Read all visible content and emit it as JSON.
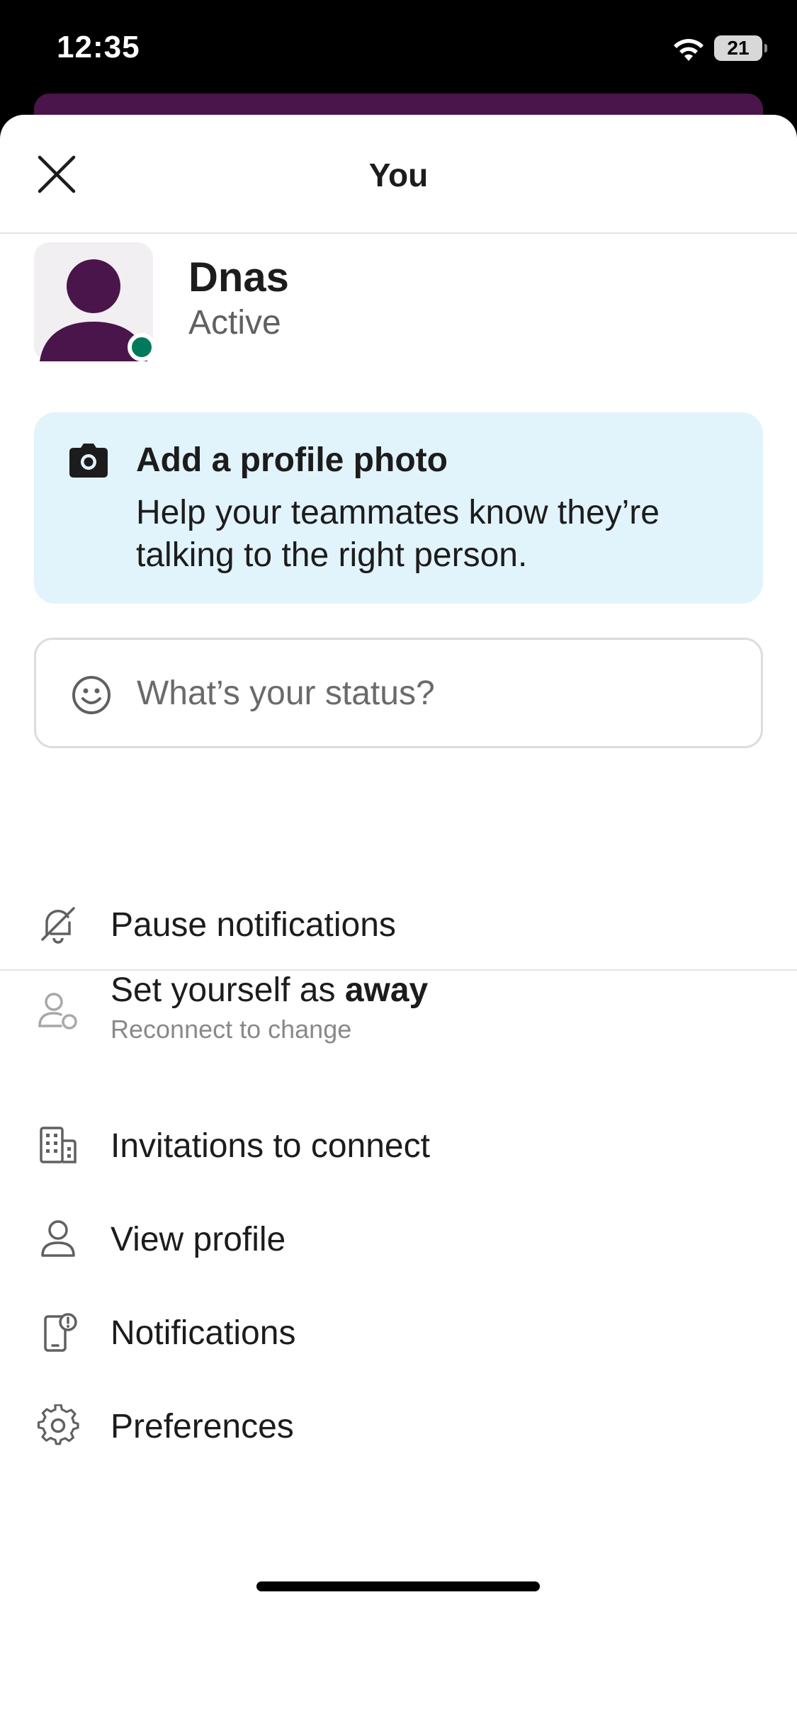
{
  "status_bar": {
    "time": "12:35",
    "battery": "21",
    "icons": [
      "wifi-icon",
      "battery-icon"
    ]
  },
  "header": {
    "title": "You",
    "close_icon": "close-icon"
  },
  "profile": {
    "name": "Dnas",
    "presence": "Active",
    "presence_color": "#007a5a",
    "avatar_color": "#4a154b"
  },
  "photo_banner": {
    "icon": "camera-icon",
    "title": "Add a profile photo",
    "description": "Help your teammates know they’re talking to the right person.",
    "background": "#e1f4fb"
  },
  "status_field": {
    "icon": "smile-icon",
    "placeholder": "What’s your status?"
  },
  "menu_top": [
    {
      "icon": "bell-off-icon",
      "label": "Pause notifications"
    },
    {
      "icon": "person-away-icon",
      "label_prefix": "Set yourself as ",
      "label_bold": "away",
      "sublabel": "Reconnect to change"
    }
  ],
  "menu_bottom": [
    {
      "icon": "building-icon",
      "label": "Invitations to connect"
    },
    {
      "icon": "person-icon",
      "label": "View profile"
    },
    {
      "icon": "phone-notification-icon",
      "label": "Notifications"
    },
    {
      "icon": "gear-icon",
      "label": "Preferences"
    }
  ]
}
